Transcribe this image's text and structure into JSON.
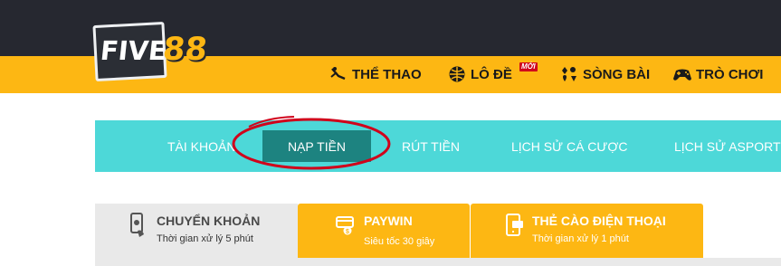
{
  "colors": {
    "header_dark": "#262830",
    "header_yellow": "#fdb713",
    "acct_bar": "#4dd8d8",
    "acct_active": "#1d8380",
    "annotation": "#d0021b",
    "card_inactive": "#e9e9e9"
  },
  "logo": {
    "word": "FIVE",
    "number": "88"
  },
  "nav": {
    "items": [
      {
        "label": "THỂ THAO",
        "icon": "sports-whistle-icon"
      },
      {
        "label": "LÔ ĐỀ",
        "icon": "lottery-ball-icon",
        "badge": "MỚI"
      },
      {
        "label": "SÒNG BÀI",
        "icon": "card-suits-icon"
      },
      {
        "label": "TRÒ CHƠI",
        "icon": "gamepad-icon"
      }
    ]
  },
  "account_tabs": {
    "items": [
      {
        "label": "TÀI KHOẢN"
      },
      {
        "label": "NẠP TIỀN",
        "active": true
      },
      {
        "label": "RÚT TIỀN"
      },
      {
        "label": "LỊCH SỬ CÁ CƯỢC"
      },
      {
        "label": "LỊCH SỬ ASPORT"
      }
    ]
  },
  "payment_methods": [
    {
      "title": "CHUYỂN KHOẢN",
      "subtitle": "Thời gian xử lý 5 phút",
      "icon": "bank-transfer-icon",
      "active": false
    },
    {
      "title": "PAYWIN",
      "subtitle": "Siêu tốc 30 giây",
      "icon": "wallet-card-icon",
      "active": true
    },
    {
      "title": "THẺ CÀO ĐIỆN THOẠI",
      "subtitle": "Thời gian xử lý 1 phút",
      "icon": "phone-card-icon",
      "active": true
    }
  ]
}
